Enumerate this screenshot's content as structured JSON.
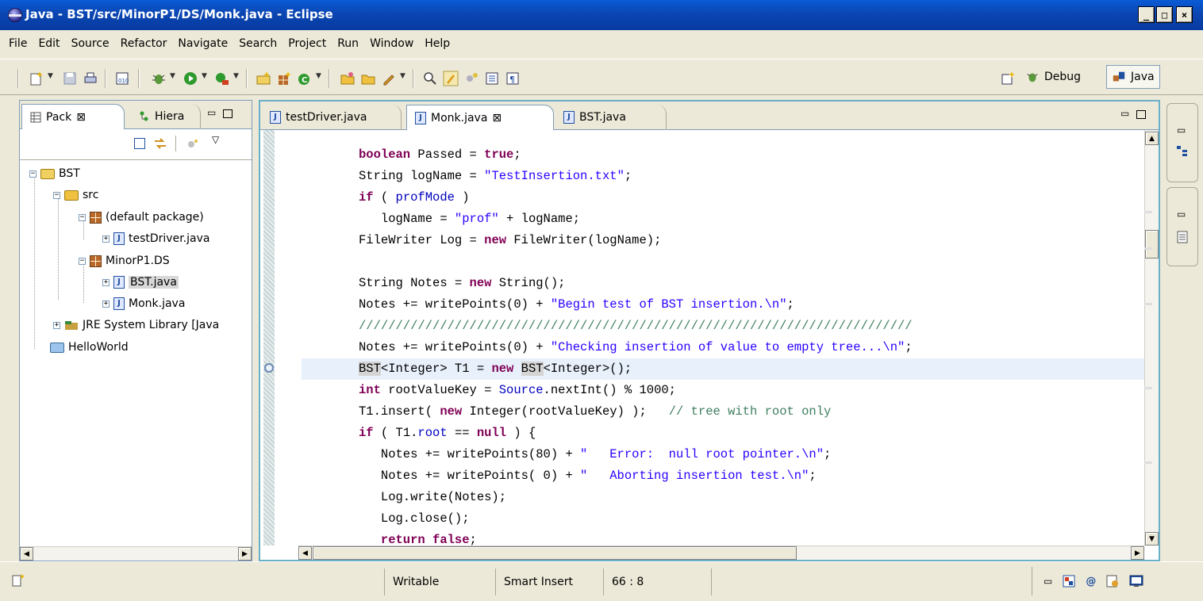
{
  "window": {
    "title": "Java - BST/src/MinorP1/DS/Monk.java - Eclipse",
    "minimize_glyph": "_",
    "maximize_glyph": "□",
    "close_glyph": "×"
  },
  "menu": [
    "File",
    "Edit",
    "Source",
    "Refactor",
    "Navigate",
    "Search",
    "Project",
    "Run",
    "Window",
    "Help"
  ],
  "perspectives": {
    "debug_label": "Debug",
    "java_label": "Java"
  },
  "left_panel": {
    "tabs": [
      {
        "label": "Pack",
        "close": "⊠"
      },
      {
        "label": "Hiera",
        "close": ""
      }
    ],
    "tree": [
      {
        "label": "BST",
        "type": "project",
        "expander": "−"
      },
      {
        "label": "src",
        "type": "source-folder",
        "expander": "−"
      },
      {
        "label": "(default package)",
        "type": "package",
        "expander": "−"
      },
      {
        "label": "testDriver.java",
        "type": "java-file",
        "expander": "+"
      },
      {
        "label": "MinorP1.DS",
        "type": "package",
        "expander": "−"
      },
      {
        "label": "BST.java",
        "type": "java-file",
        "expander": "+",
        "selected": true
      },
      {
        "label": "Monk.java",
        "type": "java-file",
        "expander": "+"
      },
      {
        "label": "JRE System Library [Java",
        "type": "library",
        "expander": "+"
      },
      {
        "label": "HelloWorld",
        "type": "project",
        "expander": ""
      }
    ]
  },
  "editor": {
    "tabs": [
      {
        "label": "testDriver.java",
        "active": false
      },
      {
        "label": "Monk.java",
        "active": true,
        "close": "⊠"
      },
      {
        "label": "BST.java",
        "active": false
      }
    ],
    "lines": [
      [
        {
          "t": "boolean",
          "c": "kw"
        },
        {
          "t": " Passed = ",
          "c": ""
        },
        {
          "t": "true",
          "c": "kw"
        },
        {
          "t": ";",
          "c": ""
        }
      ],
      [
        {
          "t": "String logName = ",
          "c": ""
        },
        {
          "t": "\"TestInsertion.txt\"",
          "c": "str"
        },
        {
          "t": ";",
          "c": ""
        }
      ],
      [
        {
          "t": "if",
          "c": "kw"
        },
        {
          "t": " ( ",
          "c": ""
        },
        {
          "t": "profMode",
          "c": "fld"
        },
        {
          "t": " )",
          "c": ""
        }
      ],
      [
        {
          "t": "   logName = ",
          "c": ""
        },
        {
          "t": "\"prof\"",
          "c": "str"
        },
        {
          "t": " + logName;",
          "c": ""
        }
      ],
      [
        {
          "t": "FileWriter Log = ",
          "c": ""
        },
        {
          "t": "new",
          "c": "kw"
        },
        {
          "t": " FileWriter(logName);",
          "c": ""
        }
      ],
      [],
      [
        {
          "t": "String Notes = ",
          "c": ""
        },
        {
          "t": "new",
          "c": "kw"
        },
        {
          "t": " String();",
          "c": ""
        }
      ],
      [
        {
          "t": "Notes += writePoints(0) + ",
          "c": ""
        },
        {
          "t": "\"Begin test of BST insertion.\\n\"",
          "c": "str"
        },
        {
          "t": ";",
          "c": ""
        }
      ],
      [
        {
          "t": "///////////////////////////////////////////////////////////////////////////",
          "c": "cmt"
        }
      ],
      [
        {
          "t": "Notes += writePoints(0) + ",
          "c": ""
        },
        {
          "t": "\"Checking insertion of value to empty tree...\\n\"",
          "c": "str"
        },
        {
          "t": ";",
          "c": ""
        }
      ],
      [
        {
          "t": "BST",
          "c": "occ"
        },
        {
          "t": "<Integer> T1 = ",
          "c": ""
        },
        {
          "t": "new",
          "c": "kw"
        },
        {
          "t": " ",
          "c": ""
        },
        {
          "t": "BST",
          "c": "occ"
        },
        {
          "t": "<Integer>();",
          "c": ""
        }
      ],
      [
        {
          "t": "int",
          "c": "kw"
        },
        {
          "t": " rootValueKey = ",
          "c": ""
        },
        {
          "t": "Source",
          "c": "fld"
        },
        {
          "t": ".nextInt() % 1000;",
          "c": ""
        }
      ],
      [
        {
          "t": "T1.insert( ",
          "c": ""
        },
        {
          "t": "new",
          "c": "kw"
        },
        {
          "t": " Integer(rootValueKey) );   ",
          "c": ""
        },
        {
          "t": "// tree with root only",
          "c": "cmt"
        }
      ],
      [
        {
          "t": "if",
          "c": "kw"
        },
        {
          "t": " ( T1.",
          "c": ""
        },
        {
          "t": "root",
          "c": "fld"
        },
        {
          "t": " == ",
          "c": ""
        },
        {
          "t": "null",
          "c": "kw"
        },
        {
          "t": " ) {",
          "c": ""
        }
      ],
      [
        {
          "t": "   Notes += writePoints(80) + ",
          "c": ""
        },
        {
          "t": "\"   Error:  null root pointer.\\n\"",
          "c": "str"
        },
        {
          "t": ";",
          "c": ""
        }
      ],
      [
        {
          "t": "   Notes += writePoints( 0) + ",
          "c": ""
        },
        {
          "t": "\"   Aborting insertion test.\\n\"",
          "c": "str"
        },
        {
          "t": ";",
          "c": ""
        }
      ],
      [
        {
          "t": "   Log.write(Notes);",
          "c": ""
        }
      ],
      [
        {
          "t": "   Log.close();",
          "c": ""
        }
      ],
      [
        {
          "t": "   ",
          "c": ""
        },
        {
          "t": "return",
          "c": "kw"
        },
        {
          "t": " ",
          "c": ""
        },
        {
          "t": "false",
          "c": "kw"
        },
        {
          "t": ";",
          "c": ""
        }
      ]
    ],
    "current_line_index": 10
  },
  "status": {
    "writable": "Writable",
    "insert_mode": "Smart Insert",
    "position": "66 : 8"
  },
  "colors": {
    "titlebar": "#0b46b3",
    "keyword": "#7f0055",
    "string": "#2a00ff",
    "comment": "#3f7f5f",
    "field": "#0000c0"
  }
}
